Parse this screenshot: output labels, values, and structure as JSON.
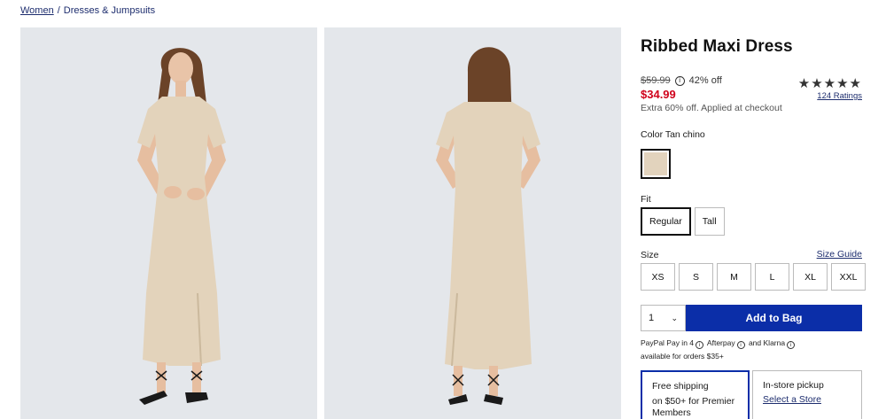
{
  "breadcrumb": {
    "home": "Women",
    "sep": "/",
    "current": "Dresses & Jumpsuits"
  },
  "product": {
    "title": "Ribbed Maxi Dress",
    "original_price": "$59.99",
    "discount": "42% off",
    "sale_price": "$34.99",
    "extra_offer": "Extra 60% off. Applied at checkout",
    "stars": "★★★★★",
    "ratings": "124 Ratings"
  },
  "color": {
    "label": "Color",
    "name": "Tan chino",
    "swatch_hex": "#e2d3bd"
  },
  "fit": {
    "label": "Fit",
    "options": [
      "Regular",
      "Tall"
    ],
    "selected": "Regular"
  },
  "size": {
    "label": "Size",
    "guide": "Size Guide",
    "options": [
      "XS",
      "S",
      "M",
      "L",
      "XL",
      "XXL"
    ]
  },
  "purchase": {
    "quantity": "1",
    "add_label": "Add to Bag"
  },
  "payments": {
    "paypal": "PayPal Pay in 4",
    "afterpay": "Afterpay",
    "and": "and",
    "klarna": "Klarna",
    "note": "available for orders $35+"
  },
  "fulfillment": {
    "shipping_title": "Free shipping",
    "shipping_detail": "on $50+ for Premier Members",
    "pickup_title": "In-store pickup",
    "pickup_link": "Select a Store"
  },
  "colors": {
    "accent": "#0b2ea8",
    "sale": "#d0021b",
    "link": "#1d2d6e"
  }
}
